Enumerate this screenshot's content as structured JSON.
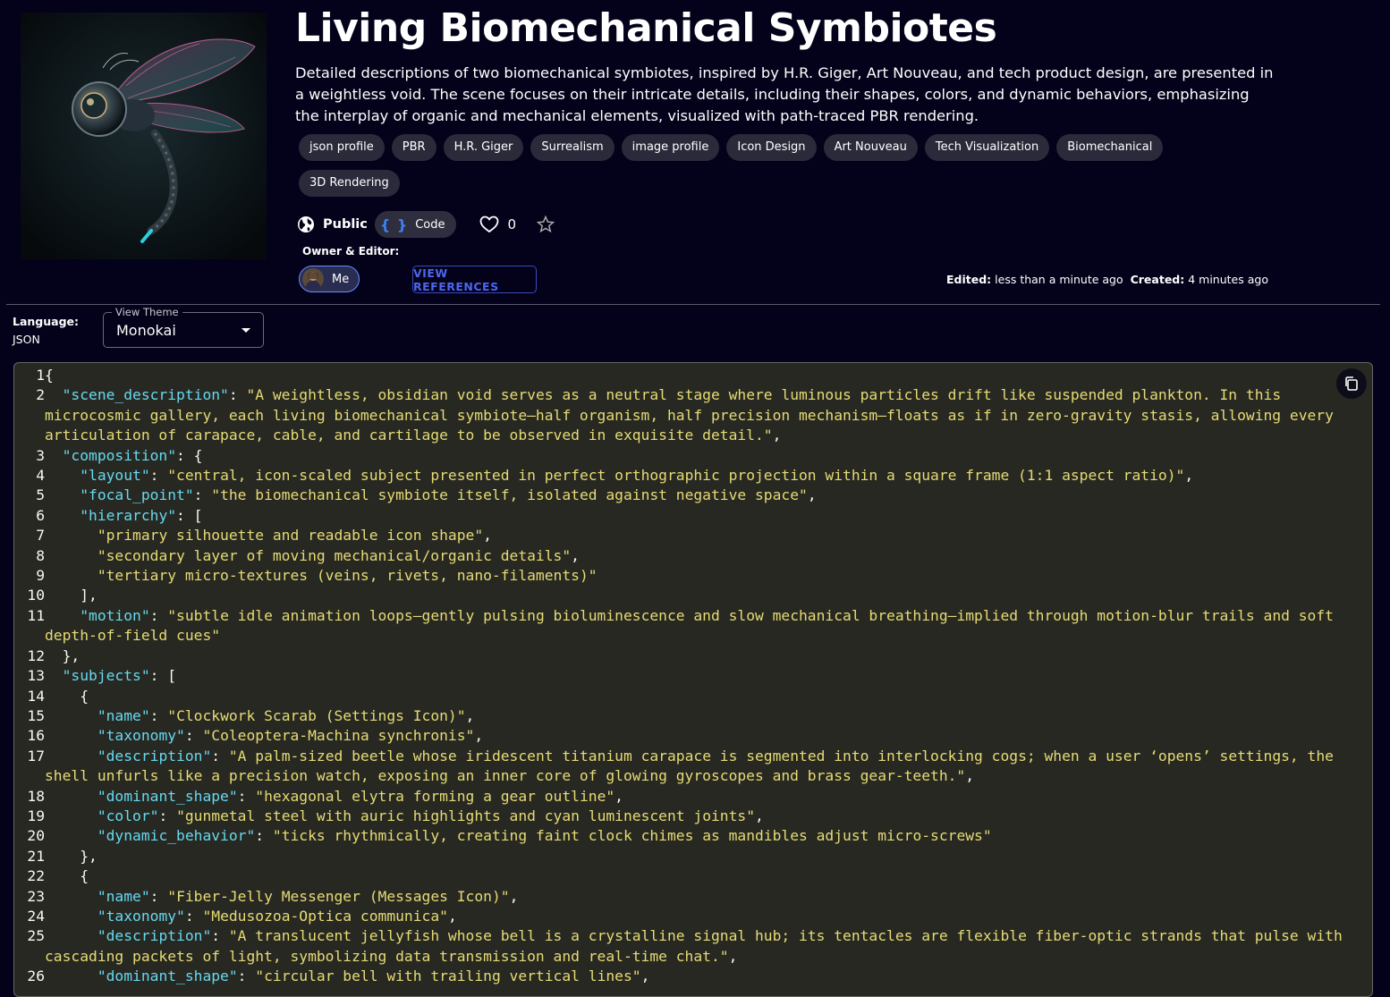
{
  "page": {
    "title": "Living Biomechanical Symbiotes",
    "description": "Detailed descriptions of two biomechanical symbiotes, inspired by H.R. Giger, Art Nouveau, and tech product design, are presented in a weightless void. The scene focuses on their intricate details, including their shapes, colors, and dynamic behaviors, emphasizing the interplay of organic and mechanical elements, visualized with path-traced PBR rendering.",
    "tags": [
      "json profile",
      "PBR",
      "H.R. Giger",
      "Surrealism",
      "image profile",
      "Icon Design",
      "Art Nouveau",
      "Tech Visualization",
      "Biomechanical",
      "3D Rendering"
    ],
    "visibility_label": "Public",
    "code_label": "Code",
    "likes_count": "0",
    "owner_label": "Owner & Editor:",
    "owner_name": "Me",
    "view_references_label": "VIEW REFERENCES",
    "edited_label": "Edited:",
    "edited_value": "less than a minute ago",
    "created_label": "Created:",
    "created_value": "4 minutes ago"
  },
  "settings": {
    "language_label": "Language:",
    "language_value": "JSON",
    "theme_label": "View Theme",
    "theme_value": "Monokai"
  },
  "icons": {
    "visibility": "globe-icon",
    "code": "braces-icon",
    "like": "heart-icon",
    "favorite": "star-icon",
    "copy": "copy-icon"
  },
  "colors": {
    "background": "#03021a",
    "editor_bg": "#272822",
    "json_key": "#66d9ef",
    "json_string": "#e6db74",
    "accent": "#4d66f0"
  },
  "code_lines": [
    {
      "n": "1",
      "parts": [
        {
          "c": "p",
          "t": "{"
        }
      ]
    },
    {
      "n": "2",
      "parts": [
        {
          "c": "p",
          "t": "  "
        },
        {
          "c": "k",
          "t": "\"scene_description\""
        },
        {
          "c": "p",
          "t": ": "
        },
        {
          "c": "s",
          "t": "\"A weightless, obsidian void serves as a neutral stage where luminous particles drift like suspended plankton. In this microcosmic gallery, each living biomechanical symbiote—half organism, half precision mechanism—floats as if in zero-gravity stasis, allowing every articulation of carapace, cable, and cartilage to be observed in exquisite detail.\""
        },
        {
          "c": "p",
          "t": ","
        }
      ]
    },
    {
      "n": "3",
      "parts": [
        {
          "c": "p",
          "t": "  "
        },
        {
          "c": "k",
          "t": "\"composition\""
        },
        {
          "c": "p",
          "t": ": {"
        }
      ]
    },
    {
      "n": "4",
      "parts": [
        {
          "c": "p",
          "t": "    "
        },
        {
          "c": "k",
          "t": "\"layout\""
        },
        {
          "c": "p",
          "t": ": "
        },
        {
          "c": "s",
          "t": "\"central, icon-scaled subject presented in perfect orthographic projection within a square frame (1:1 aspect ratio)\""
        },
        {
          "c": "p",
          "t": ","
        }
      ]
    },
    {
      "n": "5",
      "parts": [
        {
          "c": "p",
          "t": "    "
        },
        {
          "c": "k",
          "t": "\"focal_point\""
        },
        {
          "c": "p",
          "t": ": "
        },
        {
          "c": "s",
          "t": "\"the biomechanical symbiote itself, isolated against negative space\""
        },
        {
          "c": "p",
          "t": ","
        }
      ]
    },
    {
      "n": "6",
      "parts": [
        {
          "c": "p",
          "t": "    "
        },
        {
          "c": "k",
          "t": "\"hierarchy\""
        },
        {
          "c": "p",
          "t": ": ["
        }
      ]
    },
    {
      "n": "7",
      "parts": [
        {
          "c": "p",
          "t": "      "
        },
        {
          "c": "s",
          "t": "\"primary silhouette and readable icon shape\""
        },
        {
          "c": "p",
          "t": ","
        }
      ]
    },
    {
      "n": "8",
      "parts": [
        {
          "c": "p",
          "t": "      "
        },
        {
          "c": "s",
          "t": "\"secondary layer of moving mechanical/organic details\""
        },
        {
          "c": "p",
          "t": ","
        }
      ]
    },
    {
      "n": "9",
      "parts": [
        {
          "c": "p",
          "t": "      "
        },
        {
          "c": "s",
          "t": "\"tertiary micro-textures (veins, rivets, nano-filaments)\""
        }
      ]
    },
    {
      "n": "10",
      "parts": [
        {
          "c": "p",
          "t": "    ],"
        }
      ]
    },
    {
      "n": "11",
      "parts": [
        {
          "c": "p",
          "t": "    "
        },
        {
          "c": "k",
          "t": "\"motion\""
        },
        {
          "c": "p",
          "t": ": "
        },
        {
          "c": "s",
          "t": "\"subtle idle animation loops—gently pulsing bioluminescence and slow mechanical breathing—implied through motion-blur trails and soft depth-of-field cues\""
        }
      ]
    },
    {
      "n": "12",
      "parts": [
        {
          "c": "p",
          "t": "  },"
        }
      ]
    },
    {
      "n": "13",
      "parts": [
        {
          "c": "p",
          "t": "  "
        },
        {
          "c": "k",
          "t": "\"subjects\""
        },
        {
          "c": "p",
          "t": ": ["
        }
      ]
    },
    {
      "n": "14",
      "parts": [
        {
          "c": "p",
          "t": "    {"
        }
      ]
    },
    {
      "n": "15",
      "parts": [
        {
          "c": "p",
          "t": "      "
        },
        {
          "c": "k",
          "t": "\"name\""
        },
        {
          "c": "p",
          "t": ": "
        },
        {
          "c": "s",
          "t": "\"Clockwork Scarab (Settings Icon)\""
        },
        {
          "c": "p",
          "t": ","
        }
      ]
    },
    {
      "n": "16",
      "parts": [
        {
          "c": "p",
          "t": "      "
        },
        {
          "c": "k",
          "t": "\"taxonomy\""
        },
        {
          "c": "p",
          "t": ": "
        },
        {
          "c": "s",
          "t": "\"Coleoptera-Machina synchronis\""
        },
        {
          "c": "p",
          "t": ","
        }
      ]
    },
    {
      "n": "17",
      "parts": [
        {
          "c": "p",
          "t": "      "
        },
        {
          "c": "k",
          "t": "\"description\""
        },
        {
          "c": "p",
          "t": ": "
        },
        {
          "c": "s",
          "t": "\"A palm-sized beetle whose iridescent titanium carapace is segmented into interlocking cogs; when a user ‘opens’ settings, the shell unfurls like a precision watch, exposing an inner core of glowing gyroscopes and brass gear-teeth.\""
        },
        {
          "c": "p",
          "t": ","
        }
      ]
    },
    {
      "n": "18",
      "parts": [
        {
          "c": "p",
          "t": "      "
        },
        {
          "c": "k",
          "t": "\"dominant_shape\""
        },
        {
          "c": "p",
          "t": ": "
        },
        {
          "c": "s",
          "t": "\"hexagonal elytra forming a gear outline\""
        },
        {
          "c": "p",
          "t": ","
        }
      ]
    },
    {
      "n": "19",
      "parts": [
        {
          "c": "p",
          "t": "      "
        },
        {
          "c": "k",
          "t": "\"color\""
        },
        {
          "c": "p",
          "t": ": "
        },
        {
          "c": "s",
          "t": "\"gunmetal steel with auric highlights and cyan luminescent joints\""
        },
        {
          "c": "p",
          "t": ","
        }
      ]
    },
    {
      "n": "20",
      "parts": [
        {
          "c": "p",
          "t": "      "
        },
        {
          "c": "k",
          "t": "\"dynamic_behavior\""
        },
        {
          "c": "p",
          "t": ": "
        },
        {
          "c": "s",
          "t": "\"ticks rhythmically, creating faint clock chimes as mandibles adjust micro-screws\""
        }
      ]
    },
    {
      "n": "21",
      "parts": [
        {
          "c": "p",
          "t": "    },"
        }
      ]
    },
    {
      "n": "22",
      "parts": [
        {
          "c": "p",
          "t": "    {"
        }
      ]
    },
    {
      "n": "23",
      "parts": [
        {
          "c": "p",
          "t": "      "
        },
        {
          "c": "k",
          "t": "\"name\""
        },
        {
          "c": "p",
          "t": ": "
        },
        {
          "c": "s",
          "t": "\"Fiber-Jelly Messenger (Messages Icon)\""
        },
        {
          "c": "p",
          "t": ","
        }
      ]
    },
    {
      "n": "24",
      "parts": [
        {
          "c": "p",
          "t": "      "
        },
        {
          "c": "k",
          "t": "\"taxonomy\""
        },
        {
          "c": "p",
          "t": ": "
        },
        {
          "c": "s",
          "t": "\"Medusozoa-Optica communica\""
        },
        {
          "c": "p",
          "t": ","
        }
      ]
    },
    {
      "n": "25",
      "parts": [
        {
          "c": "p",
          "t": "      "
        },
        {
          "c": "k",
          "t": "\"description\""
        },
        {
          "c": "p",
          "t": ": "
        },
        {
          "c": "s",
          "t": "\"A translucent jellyfish whose bell is a crystalline signal hub; its tentacles are flexible fiber-optic strands that pulse with cascading packets of light, symbolizing data transmission and real-time chat.\""
        },
        {
          "c": "p",
          "t": ","
        }
      ]
    },
    {
      "n": "26",
      "parts": [
        {
          "c": "p",
          "t": "      "
        },
        {
          "c": "k",
          "t": "\"dominant_shape\""
        },
        {
          "c": "p",
          "t": ": "
        },
        {
          "c": "s",
          "t": "\"circular bell with trailing vertical lines\""
        },
        {
          "c": "p",
          "t": ","
        }
      ]
    }
  ]
}
